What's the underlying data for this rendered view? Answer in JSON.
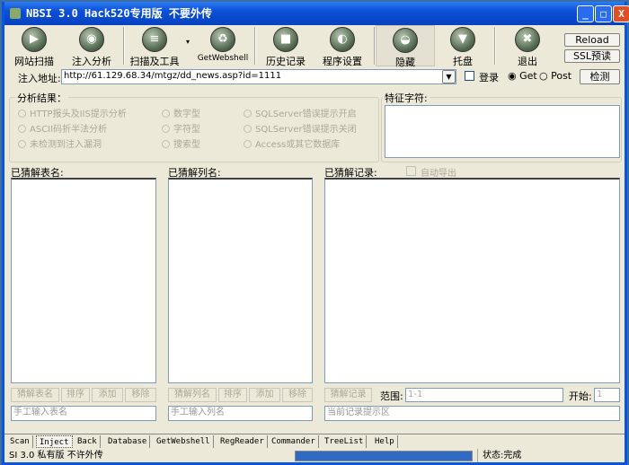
{
  "window": {
    "title": "NBSI 3.0 Hack520专用版  不要外传",
    "minimize": "_",
    "maximize": "□",
    "close": "X"
  },
  "toolbar": {
    "items": [
      {
        "label": "网站扫描",
        "icon": "play-icon",
        "glyph": "▶"
      },
      {
        "label": "注入分析",
        "icon": "eye-icon",
        "glyph": "◉"
      },
      {
        "label": "扫描及工具",
        "icon": "list-icon",
        "glyph": "≡"
      },
      {
        "label": "GetWebshell",
        "icon": "recycle-icon",
        "glyph": "♻"
      },
      {
        "label": "历史记录",
        "icon": "stop-icon",
        "glyph": "■"
      },
      {
        "label": "程序设置",
        "icon": "settings-icon",
        "glyph": "◐"
      },
      {
        "label": "隐藏",
        "icon": "hide-icon",
        "glyph": "◒"
      },
      {
        "label": "托盘",
        "icon": "tray-icon",
        "glyph": "▼"
      },
      {
        "label": "退出",
        "icon": "exit-icon",
        "glyph": "✖"
      }
    ],
    "reload": "Reload",
    "ssl": "SSL预读"
  },
  "address": {
    "label": "注入地址:",
    "value": "http://61.129.68.34/mtgz/dd_news.asp?id=1111",
    "login": "登录",
    "get": "Get",
    "post": "Post",
    "detect": "检测"
  },
  "analysis": {
    "title": "分析结果：",
    "options": [
      "HTTP报头及IIS提示分析",
      "ASCII码折半法分析",
      "未检测到注入漏洞",
      "数字型",
      "字符型",
      "搜索型",
      "SQLServer错误提示开启",
      "SQLServer错误提示关闭",
      "Access或其它数据库"
    ]
  },
  "feature": {
    "title": "特征字符:"
  },
  "tables": {
    "label": "已猜解表名:",
    "buttons": [
      "猜解表名",
      "排序",
      "添加",
      "移除"
    ],
    "placeholder": "手工输入表名"
  },
  "columns": {
    "label": "已猜解列名:",
    "buttons": [
      "猜解列名",
      "排序",
      "添加",
      "移除"
    ],
    "placeholder": "手工输入列名"
  },
  "records": {
    "label": "已猜解记录:",
    "auto_export": "自动导出",
    "guess": "猜解记录",
    "range_label": "范围:",
    "range": "1-1",
    "start_label": "开始:",
    "start": "1",
    "hint": "当前记录提示区"
  },
  "tabs": [
    "Scan",
    "Inject",
    "Back",
    "Database",
    "GetWebshell",
    "RegReader",
    "Commander",
    "TreeList",
    "Help"
  ],
  "status": {
    "left": "SI 3.0 私有版 不许外传",
    "progress": 100,
    "right": "状态:完成"
  }
}
